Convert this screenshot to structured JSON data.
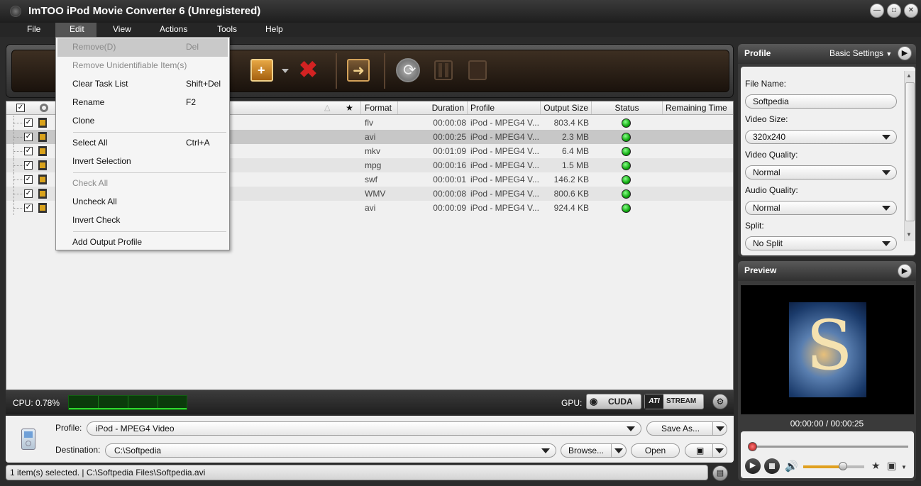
{
  "window": {
    "title": "ImTOO iPod Movie Converter 6 (Unregistered)"
  },
  "menubar": [
    "File",
    "Edit",
    "View",
    "Actions",
    "Tools",
    "Help"
  ],
  "edit_menu": {
    "items": [
      {
        "label": "Remove(D)",
        "shortcut": "Del",
        "disabled": true,
        "highlighted": true
      },
      {
        "label": "Remove Unidentifiable Item(s)",
        "shortcut": "",
        "disabled": true
      },
      {
        "label": "Clear Task List",
        "shortcut": "Shift+Del",
        "disabled": false
      },
      {
        "label": "Rename",
        "shortcut": "F2",
        "disabled": false
      },
      {
        "label": "Clone",
        "shortcut": "",
        "disabled": false
      },
      {
        "label": "Select All",
        "shortcut": "Ctrl+A",
        "disabled": false
      },
      {
        "label": "Invert Selection",
        "shortcut": "",
        "disabled": false
      },
      {
        "label": "Check All",
        "shortcut": "",
        "disabled": true
      },
      {
        "label": "Uncheck All",
        "shortcut": "",
        "disabled": false
      },
      {
        "label": "Invert Check",
        "shortcut": "",
        "disabled": false
      },
      {
        "label": "Add Output Profile",
        "shortcut": "",
        "disabled": false
      }
    ]
  },
  "list": {
    "headers": [
      "★",
      "Format",
      "Duration",
      "Profile",
      "Output Size",
      "Status",
      "Remaining Time"
    ],
    "rows": [
      {
        "format": "flv",
        "duration": "00:00:08",
        "profile": "iPod - MPEG4 V...",
        "size": "803.4 KB"
      },
      {
        "format": "avi",
        "duration": "00:00:25",
        "profile": "iPod - MPEG4 V...",
        "size": "2.3 MB"
      },
      {
        "format": "mkv",
        "duration": "00:01:09",
        "profile": "iPod - MPEG4 V...",
        "size": "6.4 MB"
      },
      {
        "format": "mpg",
        "duration": "00:00:16",
        "profile": "iPod - MPEG4 V...",
        "size": "1.5 MB"
      },
      {
        "format": "swf",
        "duration": "00:00:01",
        "profile": "iPod - MPEG4 V...",
        "size": "146.2 KB"
      },
      {
        "format": "WMV",
        "duration": "00:00:08",
        "profile": "iPod - MPEG4 V...",
        "size": "800.6 KB"
      },
      {
        "format": "avi",
        "duration": "00:00:09",
        "profile": "iPod - MPEG4 V...",
        "size": "924.4 KB"
      }
    ]
  },
  "cpu": {
    "label": "CPU: 0.78%"
  },
  "gpu": {
    "label": "GPU:",
    "cuda": "CUDA",
    "stream_ati": "ATI",
    "stream": "STREAM"
  },
  "bottom": {
    "profile_label": "Profile:",
    "profile_value": "iPod - MPEG4 Video",
    "save_as": "Save As...",
    "destination_label": "Destination:",
    "destination_value": "C:\\Softpedia",
    "browse": "Browse...",
    "open": "Open"
  },
  "statusbar": {
    "text": "1 item(s) selected. | C:\\Softpedia Files\\Softpedia.avi"
  },
  "profile_panel": {
    "title": "Profile",
    "mode": "Basic Settings",
    "file_name_label": "File Name:",
    "file_name": "Softpedia",
    "video_size_label": "Video Size:",
    "video_size": "320x240",
    "video_quality_label": "Video Quality:",
    "video_quality": "Normal",
    "audio_quality_label": "Audio Quality:",
    "audio_quality": "Normal",
    "split_label": "Split:",
    "split": "No Split"
  },
  "preview_panel": {
    "title": "Preview",
    "time": "00:00:00 / 00:00:25",
    "volume_level": 0.65
  },
  "colors": {
    "accent": "#d9a21b",
    "status_ok": "#22bb22",
    "toolbar_bg": "#2a1d14"
  }
}
